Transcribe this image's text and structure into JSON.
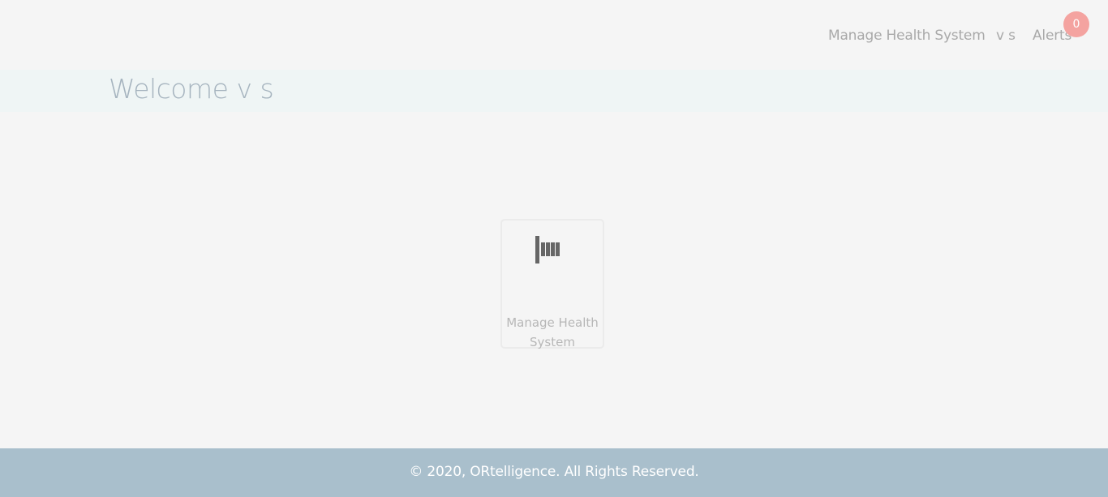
{
  "nav": {
    "manage_label": "Manage Health System",
    "user_label": "v s",
    "alerts_label": "Alerts",
    "alerts_count": "0"
  },
  "banner": {
    "welcome_text": "Welcome v s"
  },
  "tiles": [
    {
      "label": "Manage Health System",
      "icon": "building-icon"
    }
  ],
  "footer": {
    "copyright": "© 2020, ORtelligence. All Rights Reserved."
  },
  "colors": {
    "background": "#f5f5f5",
    "banner": "#eff5f5",
    "footer": "#a9bfcc",
    "badge": "#f4a3a0",
    "icon": "#666666"
  }
}
